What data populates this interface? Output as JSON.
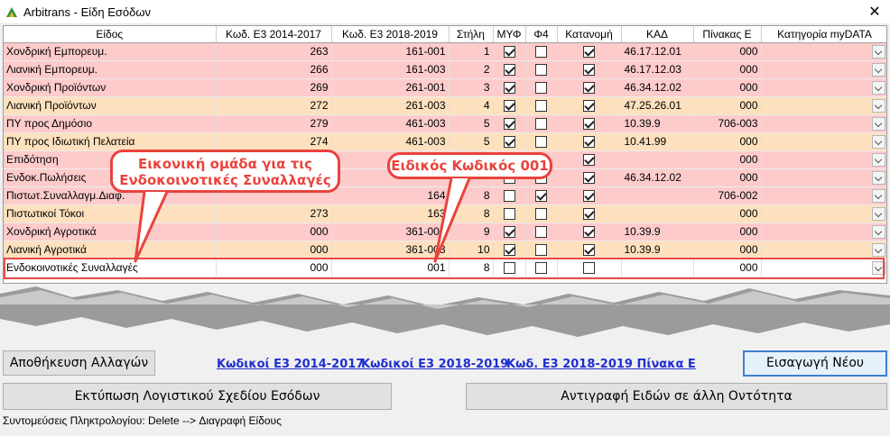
{
  "window": {
    "title": "Arbitrans - Είδη Εσόδων",
    "close_label": "✕"
  },
  "grid": {
    "columns": [
      "Είδος",
      "Κωδ. Ε3 2014-2017",
      "Κωδ. Ε3 2018-2019",
      "Στήλη",
      "ΜΥΦ",
      "Φ4",
      "Κατανομή",
      "ΚΑΔ",
      "Πίνακας Ε",
      "Κατηγορία myDATA"
    ],
    "rows": [
      {
        "style": "pink",
        "name": "Χονδρική Εμπορευμ.",
        "e3_old": "263",
        "e3_new": "161-001",
        "col": "1",
        "myf": true,
        "f4": false,
        "katanomi": true,
        "kad": "46.17.12.01",
        "pinE": "000"
      },
      {
        "style": "pink",
        "name": "Λιανική Εμπορευμ.",
        "e3_old": "266",
        "e3_new": "161-003",
        "col": "2",
        "myf": true,
        "f4": false,
        "katanomi": true,
        "kad": "46.17.12.03",
        "pinE": "000"
      },
      {
        "style": "pink",
        "name": "Χονδρική Προϊόντων",
        "e3_old": "269",
        "e3_new": "261-001",
        "col": "3",
        "myf": true,
        "f4": false,
        "katanomi": true,
        "kad": "46.34.12.02",
        "pinE": "000"
      },
      {
        "style": "peach",
        "name": "Λιανική Προϊόντων",
        "e3_old": "272",
        "e3_new": "261-003",
        "col": "4",
        "myf": true,
        "f4": false,
        "katanomi": true,
        "kad": "47.25.26.01",
        "pinE": "000"
      },
      {
        "style": "pink",
        "name": "ΠΥ προς Δημόσιο",
        "e3_old": "279",
        "e3_new": "461-003",
        "col": "5",
        "myf": true,
        "f4": false,
        "katanomi": true,
        "kad": "10.39.9",
        "pinE": "706-003"
      },
      {
        "style": "peach",
        "name": "ΠΥ προς Ιδιωτική Πελατεία",
        "e3_old": "274",
        "e3_new": "461-003",
        "col": "5",
        "myf": true,
        "f4": false,
        "katanomi": true,
        "kad": "10.41.99",
        "pinE": "000"
      },
      {
        "style": "pink",
        "name": "Επιδότηση",
        "e3_old": "",
        "e3_new": "",
        "col": "",
        "myf": false,
        "f4": false,
        "katanomi": true,
        "kad": "",
        "pinE": "000"
      },
      {
        "style": "pink",
        "name": "Ενδοκ.Πωλήσεις",
        "e3_old": "",
        "e3_new": "",
        "col": "",
        "myf": false,
        "f4": false,
        "katanomi": true,
        "kad": "46.34.12.02",
        "pinE": "000"
      },
      {
        "style": "pink",
        "name": "Πιστωτ.Συναλλαγμ.Διαφ.",
        "e3_old": "",
        "e3_new": "164",
        "col": "8",
        "myf": false,
        "f4": true,
        "katanomi": true,
        "kad": "",
        "pinE": "706-002"
      },
      {
        "style": "peach",
        "name": "Πιστωτικοί Τόκοι",
        "e3_old": "273",
        "e3_new": "163",
        "col": "8",
        "myf": false,
        "f4": false,
        "katanomi": true,
        "kad": "",
        "pinE": "000"
      },
      {
        "style": "pink",
        "name": "Χονδρική Αγροτικά",
        "e3_old": "000",
        "e3_new": "361-001",
        "col": "9",
        "myf": true,
        "f4": false,
        "katanomi": true,
        "kad": "10.39.9",
        "pinE": "000"
      },
      {
        "style": "peach",
        "name": "Λιανική Αγροτικά",
        "e3_old": "000",
        "e3_new": "361-003",
        "col": "10",
        "myf": true,
        "f4": false,
        "katanomi": true,
        "kad": "10.39.9",
        "pinE": "000"
      },
      {
        "style": "plain",
        "name": "Ενδοκοινοτικές Συναλλαγές",
        "e3_old": "000",
        "e3_new": "001",
        "col": "8",
        "myf": false,
        "f4": false,
        "katanomi": false,
        "kad": "",
        "pinE": "000"
      }
    ]
  },
  "annotations": {
    "callout_group": "Εικονική ομάδα για τις Ενδοκοινοτικές Συναλλαγές",
    "callout_code": "Ειδικός Κωδικός 001",
    "highlight_color": "#e84a4a"
  },
  "actions": {
    "save_label": "Αποθήκευση Αλλαγών",
    "link_e3_old": "Κωδικοί Ε3 2014-2017",
    "link_e3_new": "Κωδικοί Ε3 2018-2019",
    "link_e3_pinE": "Κωδ. Ε3 2018-2019 Πίνακα Ε",
    "new_label": "Εισαγωγή Νέου",
    "print_label": "Εκτύπωση Λογιστικού Σχεδίου Εσόδων",
    "copy_label": "Αντιγραφή Ειδών σε άλλη Οντότητα"
  },
  "status": {
    "shortcuts": "Συντομεύσεις Πληκτρολογίου: Delete --> Διαγραφή Είδους"
  },
  "colors": {
    "row_pink": "#fecbcb",
    "row_peach": "#fde0bd",
    "link": "#1f2fd0",
    "accent": "#e9433d"
  }
}
